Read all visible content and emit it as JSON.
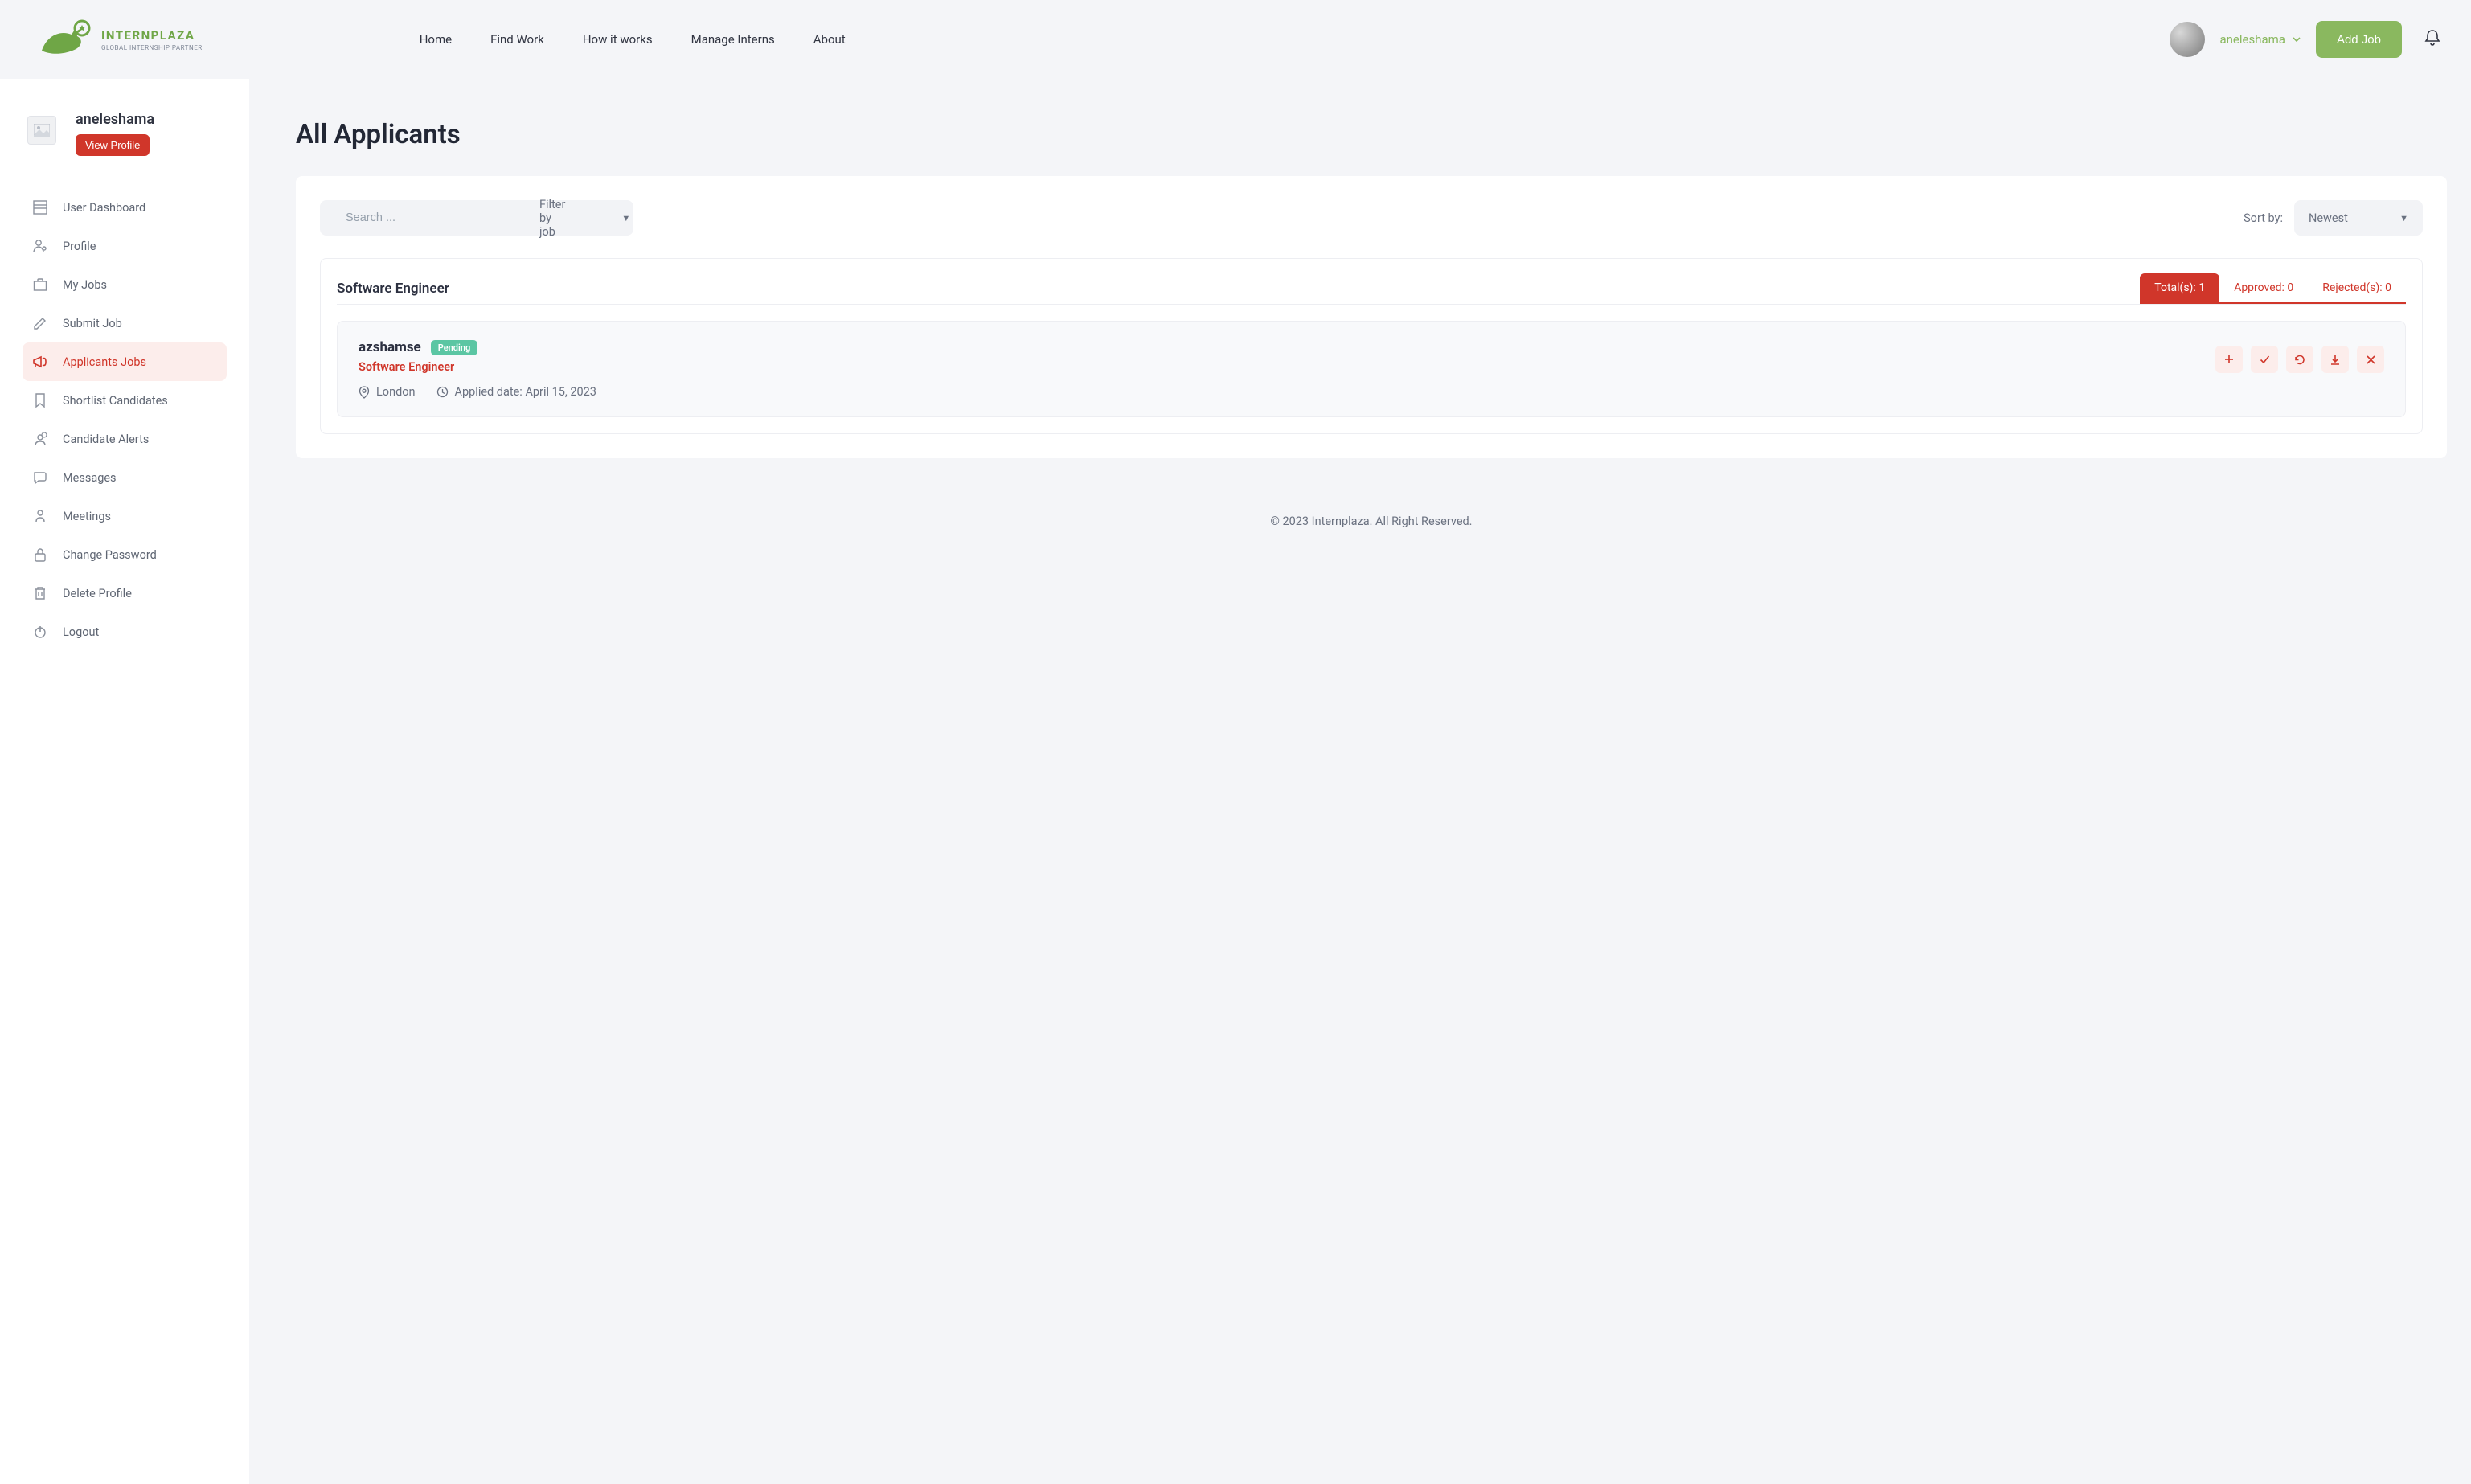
{
  "brand": {
    "title": "INTERNPLAZA",
    "tagline": "GLOBAL INTERNSHIP PARTNER"
  },
  "nav": [
    "Home",
    "Find Work",
    "How it works",
    "Manage Interns",
    "About"
  ],
  "header": {
    "username": "aneleshama",
    "add_job": "Add Job"
  },
  "sidebar": {
    "profile_name": "aneleshama",
    "view_profile": "View Profile",
    "items": [
      {
        "id": "dashboard",
        "label": "User Dashboard"
      },
      {
        "id": "profile",
        "label": "Profile"
      },
      {
        "id": "myjobs",
        "label": "My Jobs"
      },
      {
        "id": "submitjob",
        "label": "Submit Job"
      },
      {
        "id": "applicants",
        "label": "Applicants Jobs",
        "active": true
      },
      {
        "id": "shortlist",
        "label": "Shortlist Candidates"
      },
      {
        "id": "alerts",
        "label": "Candidate Alerts"
      },
      {
        "id": "messages",
        "label": "Messages"
      },
      {
        "id": "meetings",
        "label": "Meetings"
      },
      {
        "id": "changepw",
        "label": "Change Password"
      },
      {
        "id": "deleteprofile",
        "label": "Delete Profile"
      },
      {
        "id": "logout",
        "label": "Logout"
      }
    ]
  },
  "page": {
    "title": "All Applicants",
    "search_placeholder": "Search ...",
    "filter_label": "Filter by job",
    "sort_by_label": "Sort by:",
    "sort_value": "Newest"
  },
  "job": {
    "title": "Software Engineer",
    "tabs": {
      "total": {
        "label": "Total(s):",
        "count": 1
      },
      "approved": {
        "label": "Approved:",
        "count": 0
      },
      "rejected": {
        "label": "Rejected(s):",
        "count": 0
      }
    },
    "applicant": {
      "name": "azshamse",
      "status": "Pending",
      "position": "Software Engineer",
      "location": "London",
      "applied_label": "Applied date:",
      "applied_date": "April 15, 2023"
    }
  },
  "footer": "© 2023 Internplaza. All Right Reserved."
}
